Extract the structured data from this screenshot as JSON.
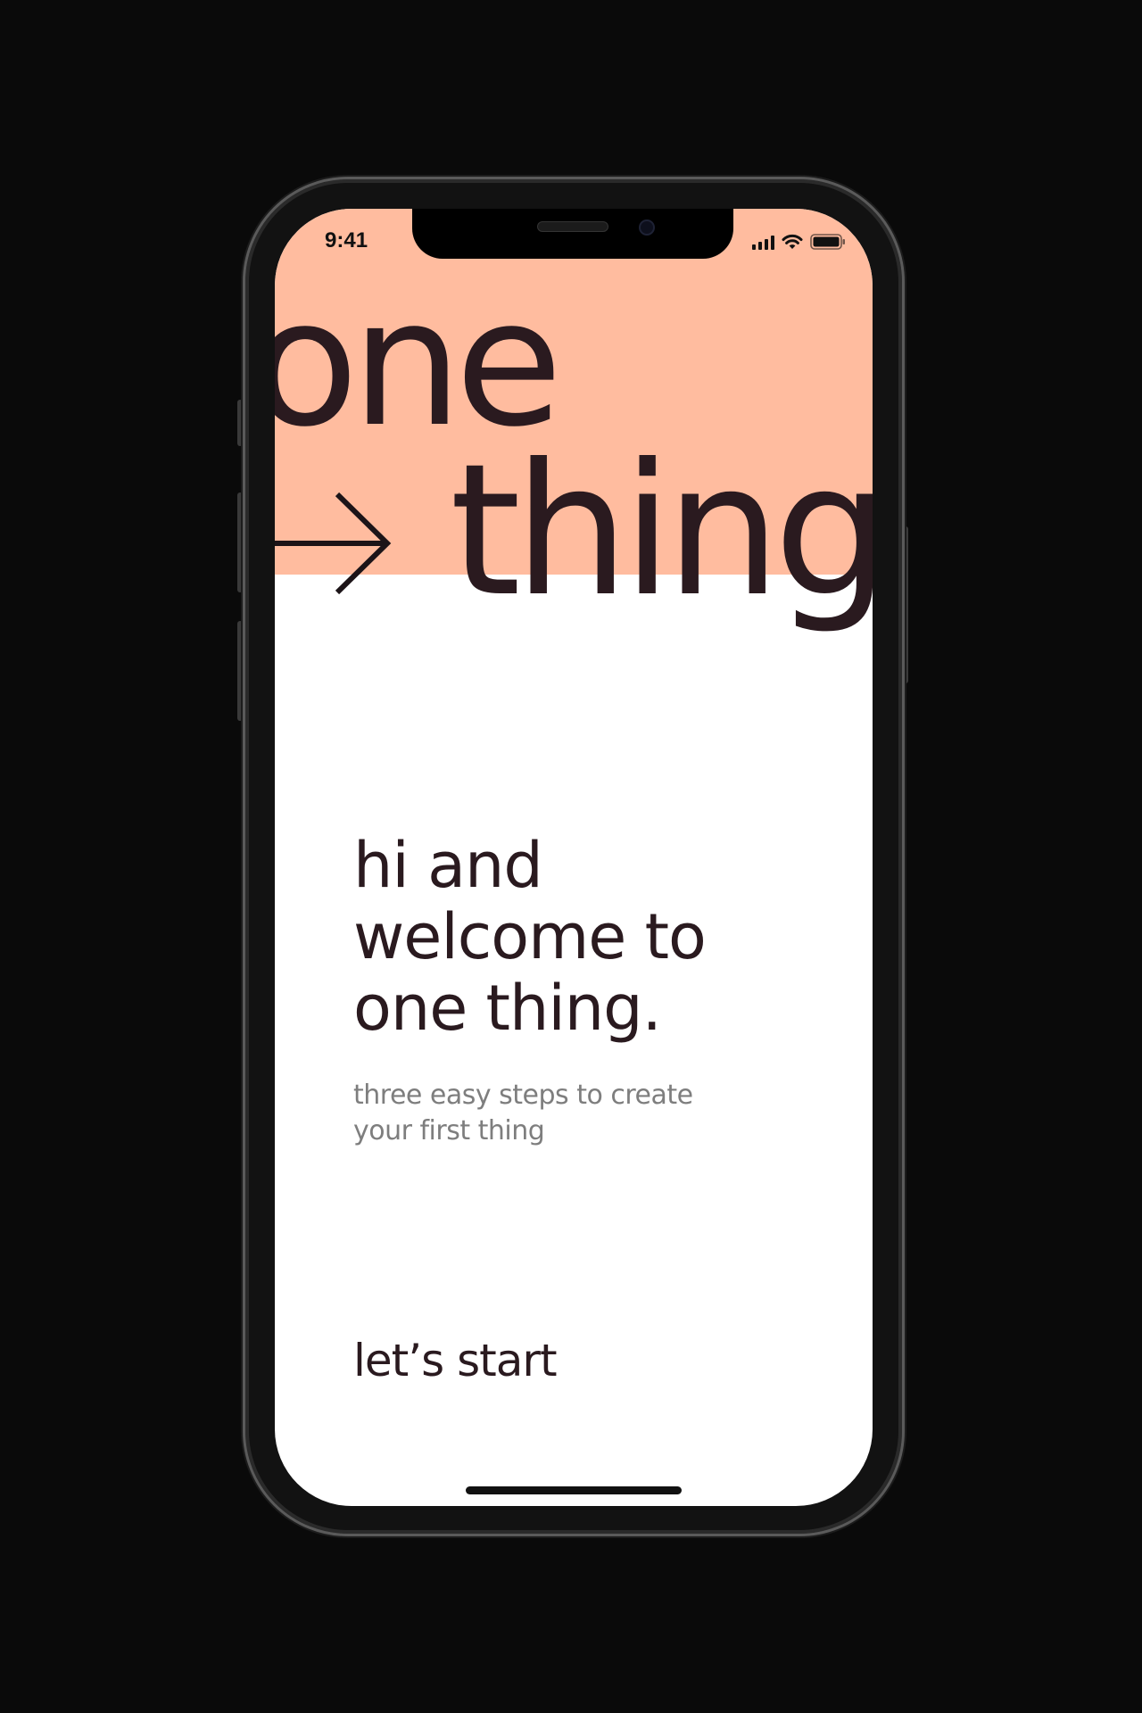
{
  "status_bar": {
    "time": "9:41",
    "icons": [
      "signal-icon",
      "wifi-icon",
      "battery-icon"
    ]
  },
  "hero": {
    "word_one": "one",
    "word_two": "thing",
    "arrow_icon": "arrow-right-icon",
    "band_color": "#ffbc9f",
    "text_color": "#2a1a1f"
  },
  "welcome": {
    "heading": "hi and welcome to one thing.",
    "subtitle": "three easy steps to create your first thing"
  },
  "actions": {
    "start_label": "let’s start"
  }
}
